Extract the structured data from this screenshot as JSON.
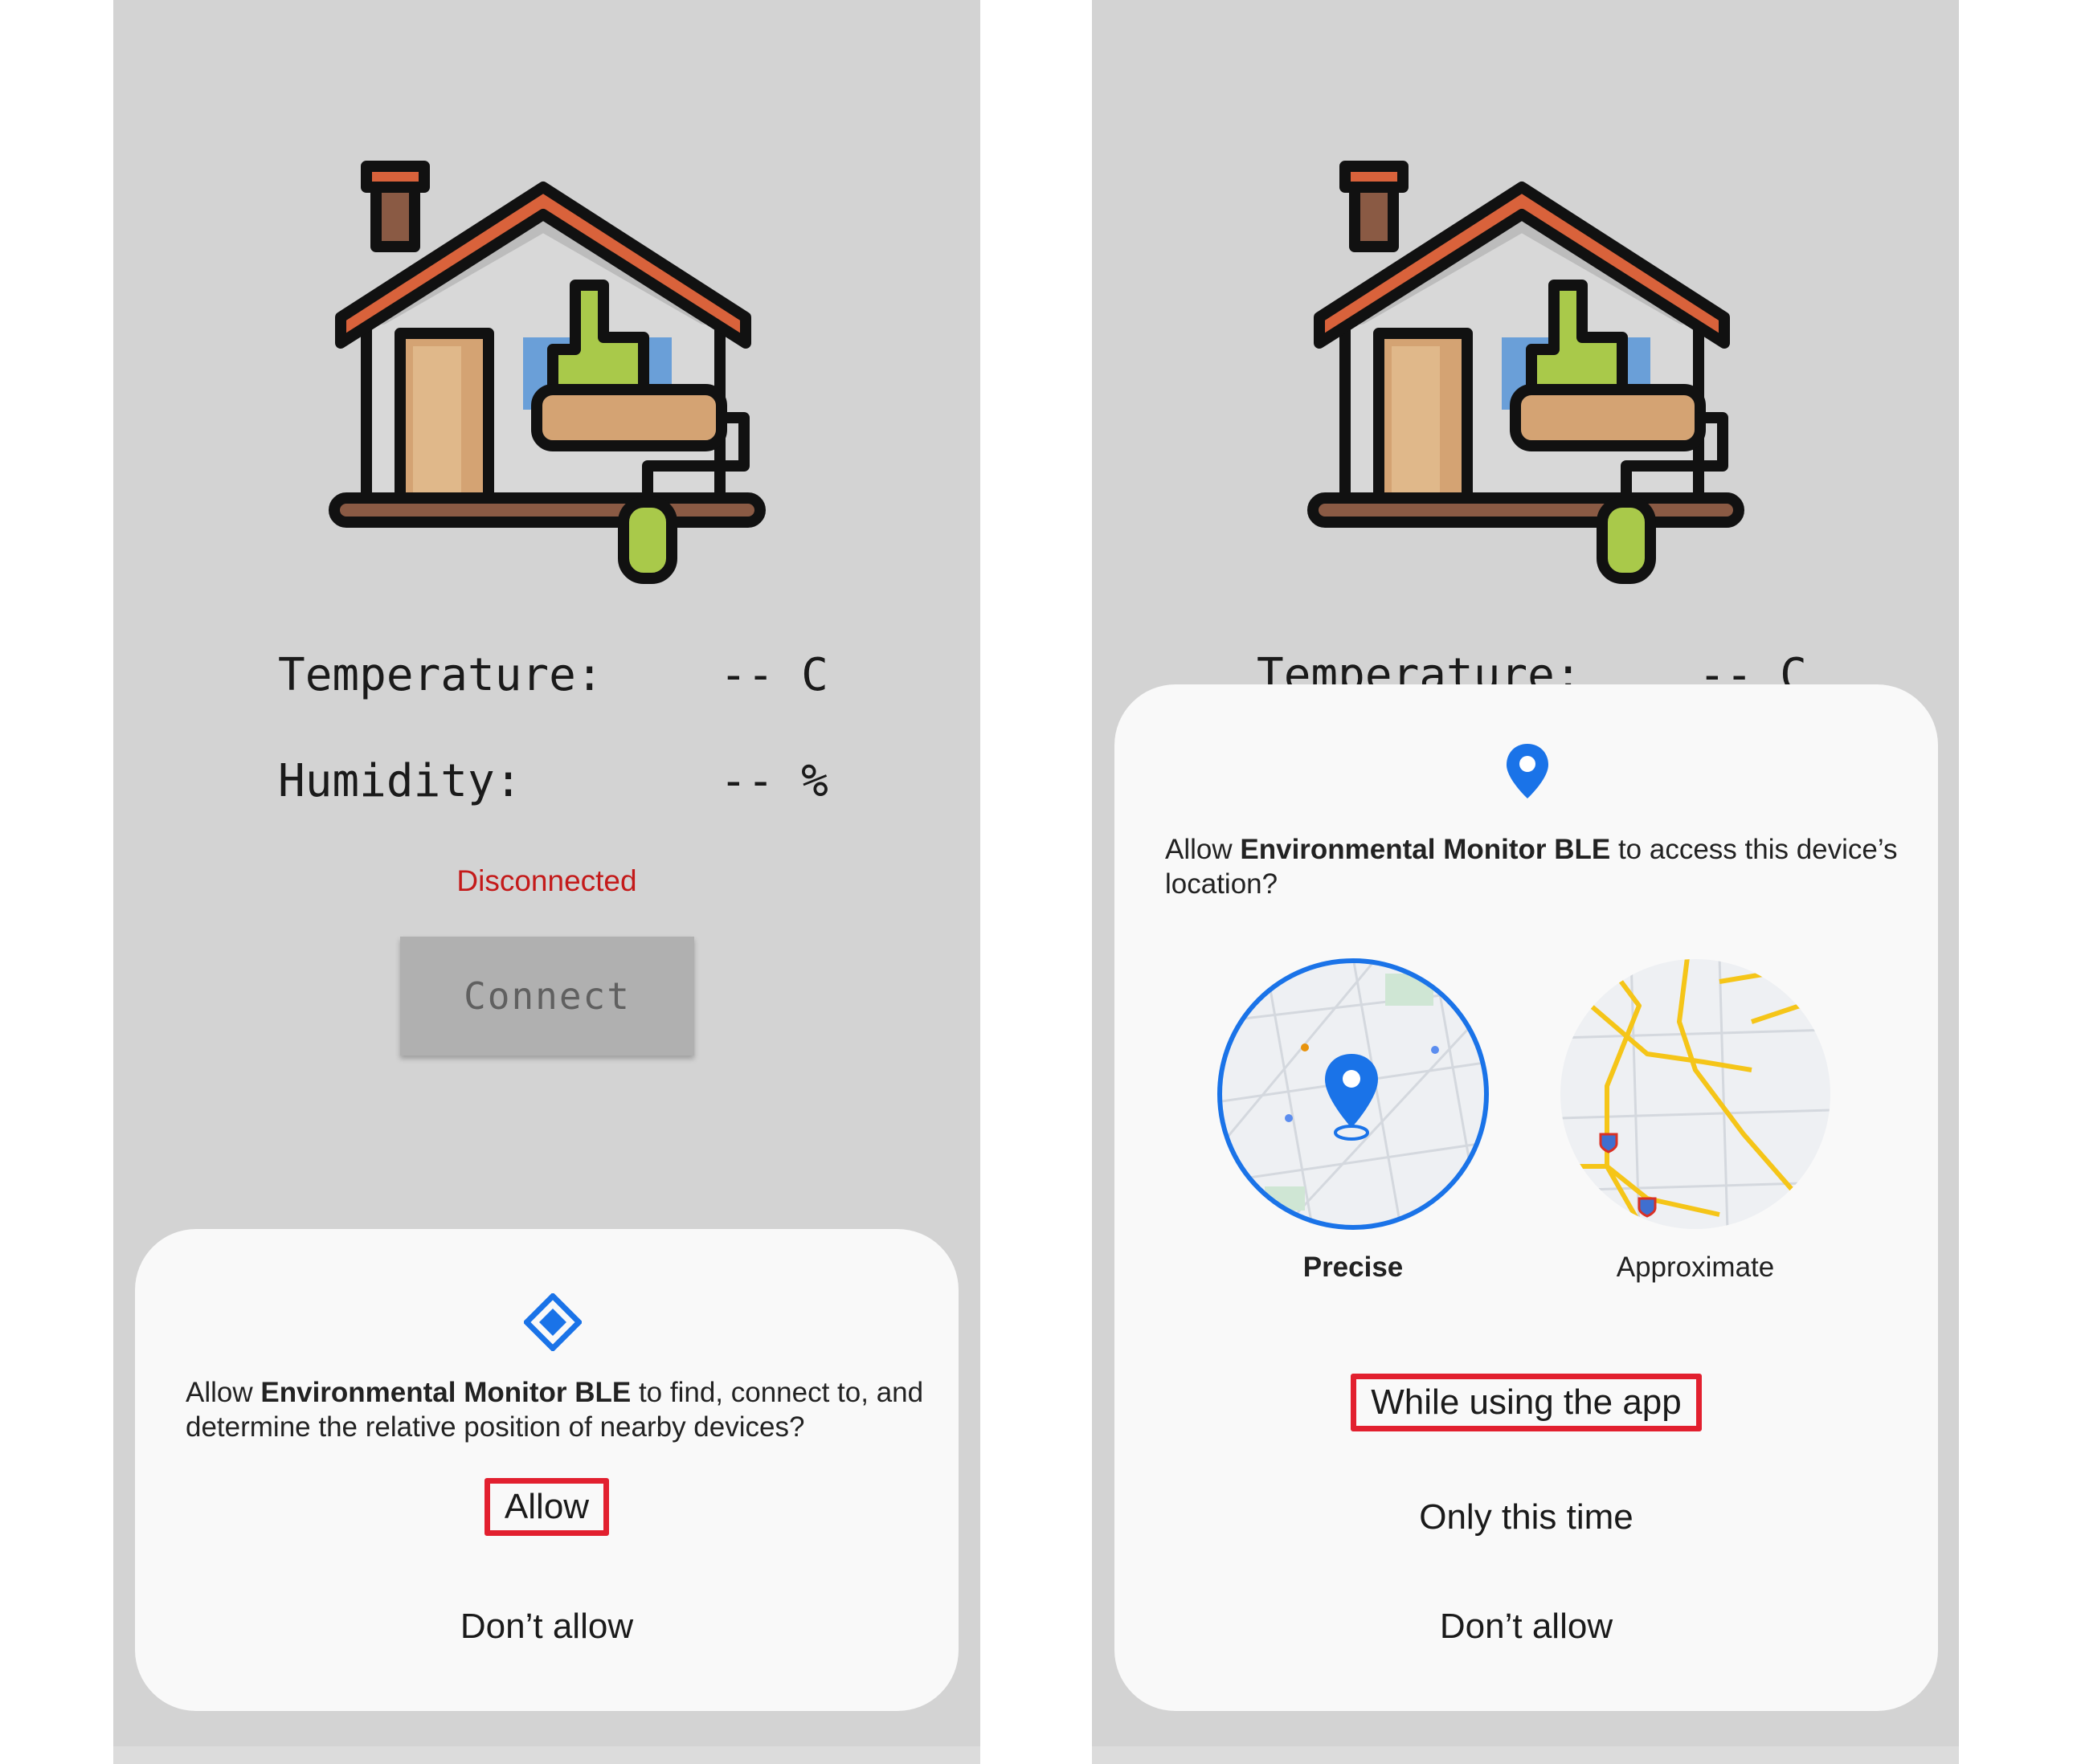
{
  "left_screen": {
    "readings": [
      {
        "label": "Temperature:",
        "value": "-- C"
      },
      {
        "label": "Humidity:",
        "value": "-- %"
      }
    ],
    "status": "Disconnected",
    "connect_label": "Connect",
    "dialog": {
      "icon": "nearby-devices-icon",
      "prompt_prefix": "Allow ",
      "app_name": "Environmental Monitor BLE",
      "prompt_suffix": " to find, connect to, and determine the relative position of nearby devices?",
      "allow_label": "Allow",
      "deny_label": "Don’t allow"
    }
  },
  "right_screen": {
    "readings": [
      {
        "label": "Temperature:",
        "value": "-- C"
      }
    ],
    "dialog": {
      "icon": "location-pin-icon",
      "prompt_prefix": "Allow ",
      "app_name": "Environmental Monitor BLE",
      "prompt_suffix": " to access this device’s location?",
      "precise_label": "Precise",
      "approximate_label": "Approximate",
      "while_using_label": "While using the app",
      "only_this_time_label": "Only this time",
      "deny_label": "Don’t allow"
    }
  },
  "colors": {
    "highlight": "#e2202f",
    "status_red": "#c41a1a",
    "accent_blue": "#1a73e8"
  }
}
